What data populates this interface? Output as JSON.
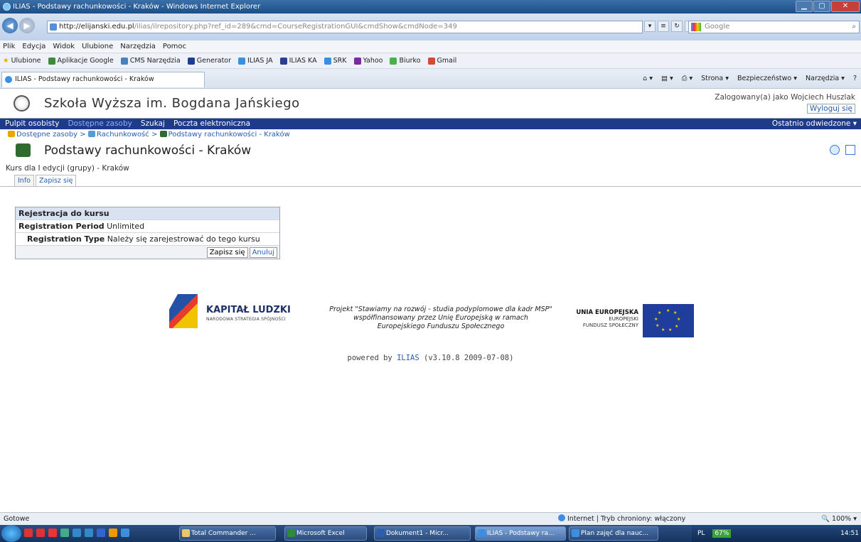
{
  "window": {
    "title": "ILIAS - Podstawy rachunkowości - Kraków - Windows Internet Explorer",
    "url_host": "http://elijanski.edu.pl",
    "url_path": "/ilias/ilrepository.php?ref_id=289&cmd=CourseRegistrationGUI&cmdShow&cmdNode=349",
    "search_placeholder": "Google"
  },
  "menubar": [
    "Plik",
    "Edycja",
    "Widok",
    "Ulubione",
    "Narzędzia",
    "Pomoc"
  ],
  "favorites": {
    "label": "Ulubione",
    "items": [
      "Aplikacje Google",
      "CMS Narzędzia",
      "Generator",
      "ILIAS JA",
      "ILIAS KA",
      "SRK",
      "Yahoo",
      "Biurko",
      "Gmail"
    ]
  },
  "tab": {
    "title": "ILIAS - Podstawy rachunkowości - Kraków"
  },
  "commandbar": [
    "Strona ▾",
    "Bezpieczeństwo ▾",
    "Narzędzia ▾",
    "?"
  ],
  "site": {
    "name": "Szkoła Wyższa im. Bogdana Jańskiego",
    "logged_in_as": "Zalogowany(a) jako Wojciech Huszlak",
    "logout": "Wyloguj się"
  },
  "mainmenu": {
    "items": [
      "Pulpit osobisty",
      "Dostępne zasoby",
      "Szukaj",
      "Poczta elektroniczna"
    ],
    "recent": "Ostatnio odwiedzone ▾"
  },
  "breadcrumb": [
    "Dostępne zasoby",
    "Rachunkowość",
    "Podstawy rachunkowości - Kraków"
  ],
  "course": {
    "title": "Podstawy rachunkowości - Kraków",
    "description": "Kurs dla I edycji (grupy) - Kraków",
    "tabs": [
      "Info",
      "Zapisz się"
    ]
  },
  "registration": {
    "header": "Rejestracja do kursu",
    "period_label": "Registration Period",
    "period_value": "Unlimited",
    "type_label": "Registration Type",
    "type_value": "Należy się zarejestrować do tego kursu",
    "submit": "Zapisz się",
    "cancel": "Anuluj"
  },
  "footer": {
    "kl_title": "KAPITAŁ LUDZKI",
    "kl_sub": "NARODOWA STRATEGIA SPÓJNOŚCI",
    "project_line1": "Projekt \"Stawiamy na rozwój - studia podyplomowe dla kadr MSP\"",
    "project_line2": "współfinansowany przez Unię Europejską w ramach",
    "project_line3": "Europejskiego Funduszu Społecznego",
    "ue_title": "UNIA EUROPEJSKA",
    "ue_line2": "EUROPEJSKI",
    "ue_line3": "FUNDUSZ SPOŁECZNY",
    "powered_prefix": "powered by",
    "powered_link": "ILIAS",
    "powered_version": "(v3.10.8 2009-07-08)"
  },
  "statusbar": {
    "status": "Gotowe",
    "zone": "Internet | Tryb chroniony: włączony",
    "zoom": "100%"
  },
  "taskbar": {
    "tasks": [
      "Total Commander ...",
      "Microsoft Excel",
      "Dokument1 - Micr...",
      "ILIAS - Podstawy ra...",
      "Plan zajęć dla nauc..."
    ],
    "lang": "PL",
    "battery": "67%",
    "clock": "14:51"
  }
}
